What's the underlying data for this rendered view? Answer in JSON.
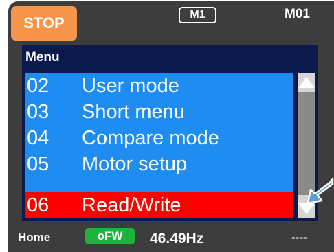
{
  "top_bar": {
    "stop_label": "STOP",
    "motor_badge": "M1",
    "mode_code": "M01"
  },
  "menu": {
    "title": "Menu",
    "items": [
      {
        "number": "02",
        "label": "User mode",
        "selected": false
      },
      {
        "number": "03",
        "label": "Short menu",
        "selected": false
      },
      {
        "number": "04",
        "label": "Compare mode",
        "selected": false
      },
      {
        "number": "05",
        "label": "Motor setup",
        "selected": false
      },
      {
        "number": "06",
        "label": "Read/Write",
        "selected": true
      }
    ]
  },
  "status_bar": {
    "location": "Home",
    "status_badge": "oFW",
    "frequency": "46.49Hz",
    "extra": "----"
  },
  "icons": {
    "scroll_up": "triangle-up-icon",
    "scroll_down": "triangle-down-icon",
    "pointer": "pointer-arrow-icon"
  },
  "colors": {
    "background": "#3d3d3d",
    "stop": "#f7954a",
    "menu_header": "#0b1a4d",
    "menu_item": "#1e8cf0",
    "selected_item": "#ff0000",
    "status_badge": "#1fb33d",
    "pointer": "#5a9fd6"
  }
}
